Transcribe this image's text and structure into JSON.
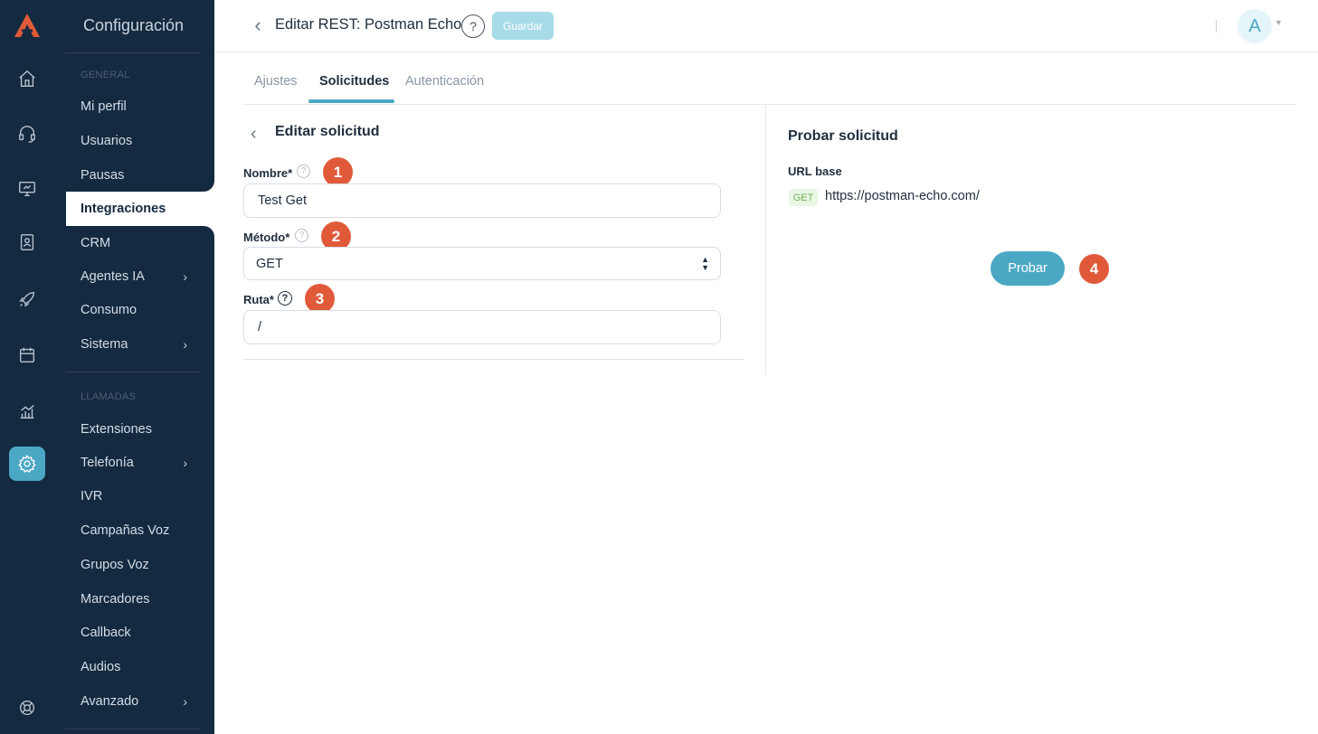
{
  "app": {
    "brand_color": "#e05a3a",
    "accent_color": "#4ba8c5",
    "sidebar_color": "#142a40"
  },
  "rail": {
    "icons": [
      "home-icon",
      "headset-icon",
      "monitor-icon",
      "contacts-icon",
      "rocket-icon",
      "calendar-icon",
      "chart-icon",
      "settings-icon",
      "help-lifebuoy-icon"
    ],
    "active": "settings-icon"
  },
  "sidebar": {
    "title": "Configuración",
    "section_general": "GENERAL",
    "section_llamadas": "LLAMADAS",
    "items": [
      {
        "label": "Mi perfil"
      },
      {
        "label": "Usuarios"
      },
      {
        "label": "Pausas"
      },
      {
        "label": "Integraciones"
      },
      {
        "label": "CRM"
      },
      {
        "label": "Agentes IA"
      },
      {
        "label": "Consumo"
      },
      {
        "label": "Sistema"
      },
      {
        "label": "Extensiones"
      },
      {
        "label": "Telefonía"
      },
      {
        "label": "IVR"
      },
      {
        "label": "Campañas Voz"
      },
      {
        "label": "Grupos Voz"
      },
      {
        "label": "Marcadores"
      },
      {
        "label": "Callback"
      },
      {
        "label": "Audios"
      },
      {
        "label": "Avanzado"
      }
    ],
    "active": "Integraciones"
  },
  "header": {
    "title": "Editar REST: Postman Echo",
    "help": "?",
    "save_label": "Guardar",
    "avatar_initial": "A"
  },
  "tabs": [
    {
      "label": "Ajustes"
    },
    {
      "label": "Solicitudes"
    },
    {
      "label": "Autenticación"
    }
  ],
  "active_tab": "Solicitudes",
  "edit_request": {
    "title": "Editar solicitud",
    "nombre_label": "Nombre*",
    "nombre_value": "Test Get",
    "metodo_label": "Método*",
    "metodo_value": "GET",
    "ruta_label": "Ruta*",
    "ruta_value": "/"
  },
  "test_request": {
    "title": "Probar solicitud",
    "base_url_label": "URL base",
    "method": "GET",
    "base_url": "https://postman-echo.com/",
    "probar_label": "Probar"
  },
  "badges": [
    "1",
    "2",
    "3",
    "4"
  ]
}
